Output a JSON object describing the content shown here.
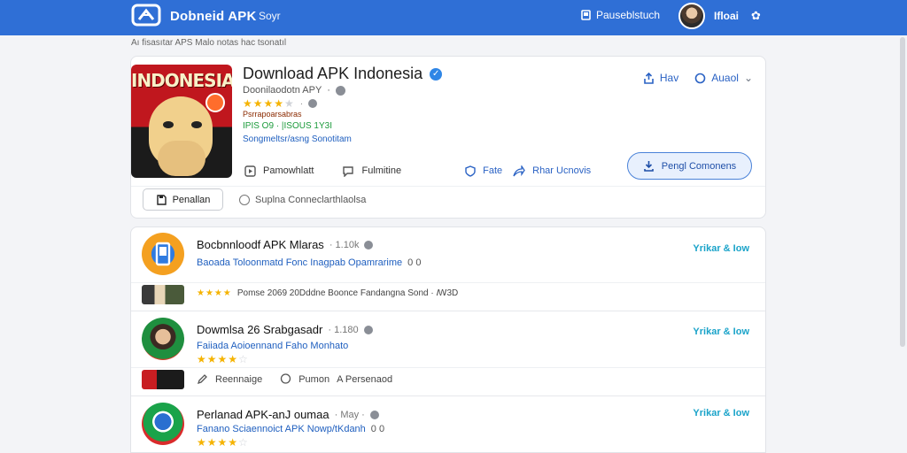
{
  "topbar": {
    "brand": "Dobneid APK",
    "brand_sub": "Soyr",
    "action_label": "Pauseblstuch",
    "user_name": "Ifloai"
  },
  "breadcrumb": "Aı fisasıtar APS Malo notas hac tsonatıl",
  "hero": {
    "title": "Download APK Indonesia",
    "developer": "Doonilaodotn APY",
    "thumb_banner": "INDONESIA",
    "rating_label": "Psrrapoarsabras",
    "meta": "IPIS O9 · |ISOUS 1Y3I",
    "tag": "Songmeltsr/asng Sonotitam",
    "share_label": "Hav",
    "more_label": "Auaol",
    "actions": {
      "primary_left": "Pamowhlatt",
      "comment": "Fulmitine",
      "fate": "Fate",
      "share": "Rhar Ucnovis",
      "primary_button": "Pengl Comonens"
    },
    "secondary_button": "Penallan",
    "secondary_hint": "Suplna Conneclarthlaolsa",
    "stars_filled": 4,
    "stars_total": 5
  },
  "list": [
    {
      "title": "Bocbnnloodf APK Mlaras",
      "meta": "· 1.10k",
      "sub": "Baoada Toloonmatd Fonc Inagpab Opamrarime",
      "count": "0 0",
      "link": "Yrikar & Iow",
      "sub_meta": "Pomse 2069 20Dddne Boonce Fandangna Sond · ꟿ3D",
      "sub_highlight": "Pomse"
    },
    {
      "title": "Dowmlsa 26 Srabgasadr",
      "meta": "· 1.180",
      "sub": "Faiiada Aoioennand Faho Monhato",
      "link": "Yrikar & Iow",
      "stars_filled": 4,
      "action_a": "Reennaige",
      "action_b": "Pumon",
      "action_c": "A Persenaod"
    },
    {
      "title": "Perlanad APK-anJ oumaa",
      "meta": "· May ·",
      "sub": "Fanano Sciaennoict APK Nowp/tKdanh",
      "count": "0 0",
      "link": "Yrikar & Iow",
      "stars_filled": 4
    }
  ],
  "colors": {
    "topbar": "#2f6fd6",
    "accent": "#2a62c4",
    "link": "#1aa3c9",
    "star": "#f5b301"
  }
}
